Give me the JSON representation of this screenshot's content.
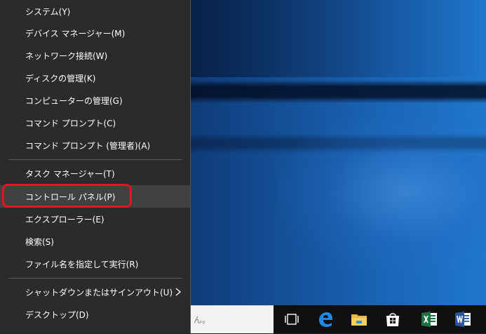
{
  "menu": {
    "items": [
      {
        "label": "システム(Y)"
      },
      {
        "label": "デバイス マネージャー(M)"
      },
      {
        "label": "ネットワーク接続(W)"
      },
      {
        "label": "ディスクの管理(K)"
      },
      {
        "label": "コンピューターの管理(G)"
      },
      {
        "label": "コマンド プロンプト(C)"
      },
      {
        "label": "コマンド プロンプト (管理者)(A)"
      },
      {
        "label": "タスク マネージャー(T)"
      },
      {
        "label": "コントロール パネル(P)"
      },
      {
        "label": "エクスプローラー(E)"
      },
      {
        "label": "検索(S)"
      },
      {
        "label": "ファイル名を指定して実行(R)"
      },
      {
        "label": "シャットダウンまたはサインアウト(U)"
      },
      {
        "label": "デスクトップ(D)"
      }
    ]
  },
  "taskbar": {
    "search_text": "ん。",
    "icons": [
      "task-view-icon",
      "edge-icon",
      "file-explorer-icon",
      "store-icon",
      "excel-icon",
      "word-icon"
    ]
  },
  "colors": {
    "menu_bg": "#2b2b2b",
    "hover_bg": "#414141",
    "highlight": "#e5141e",
    "taskbar_bg": "#101010",
    "edge_blue": "#1e88e5",
    "excel_green": "#1e7145",
    "word_blue": "#2b579a"
  }
}
